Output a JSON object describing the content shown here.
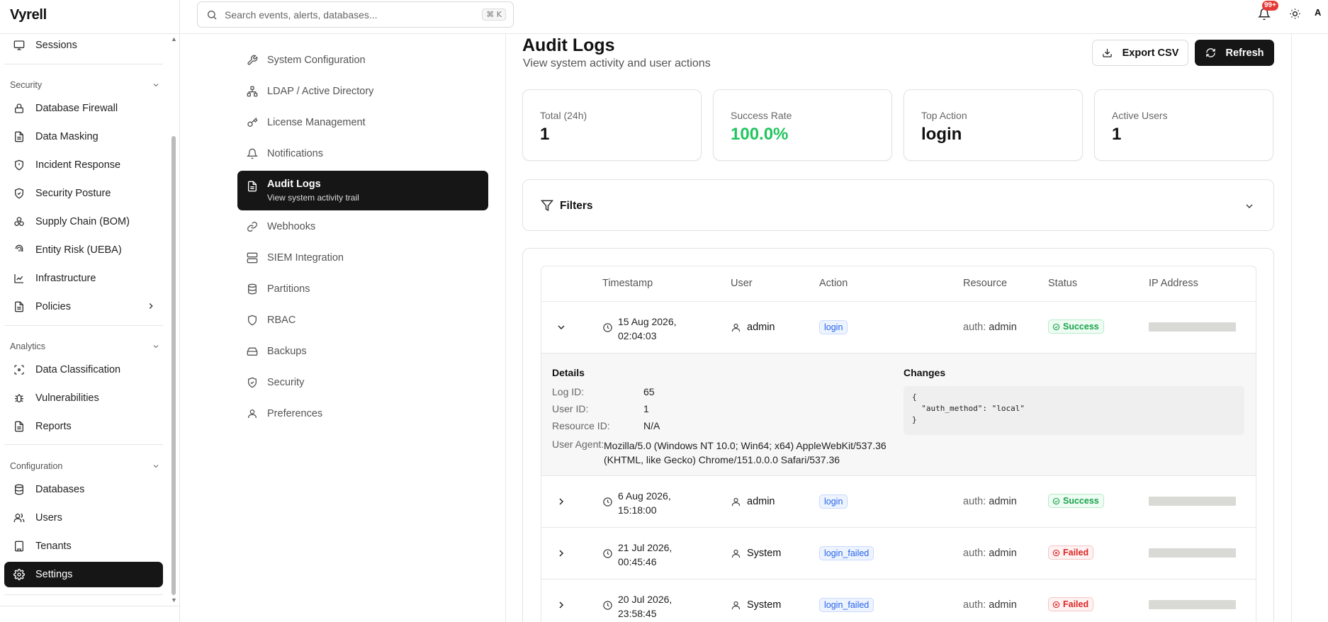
{
  "app": {
    "brand": "Vyrell"
  },
  "topbar": {
    "search_placeholder": "Search events, alerts, databases...",
    "search_shortcut": "⌘ K",
    "notifications_badge": "99+",
    "avatar_initial": "A"
  },
  "sidebar": {
    "top_items": [
      {
        "label": "Sessions",
        "icon": "monitor-icon"
      }
    ],
    "sections": [
      {
        "title": "Security",
        "items": [
          {
            "label": "Database Firewall",
            "icon": "lock-icon"
          },
          {
            "label": "Data Masking",
            "icon": "file-icon"
          },
          {
            "label": "Incident Response",
            "icon": "shield-alert-icon"
          },
          {
            "label": "Security Posture",
            "icon": "shield-check-icon"
          },
          {
            "label": "Supply Chain (BOM)",
            "icon": "boxes-icon"
          },
          {
            "label": "Entity Risk (UEBA)",
            "icon": "fingerprint-icon"
          },
          {
            "label": "Infrastructure",
            "icon": "chart-icon"
          },
          {
            "label": "Policies",
            "icon": "file-icon"
          }
        ]
      },
      {
        "title": "Analytics",
        "items": [
          {
            "label": "Data Classification",
            "icon": "scan-icon"
          },
          {
            "label": "Vulnerabilities",
            "icon": "bug-icon"
          },
          {
            "label": "Reports",
            "icon": "file-icon"
          }
        ]
      },
      {
        "title": "Configuration",
        "items": [
          {
            "label": "Databases",
            "icon": "database-icon"
          },
          {
            "label": "Users",
            "icon": "users-icon"
          },
          {
            "label": "Tenants",
            "icon": "building-icon"
          },
          {
            "label": "Settings",
            "icon": "gear-icon"
          }
        ]
      }
    ]
  },
  "settings_nav": {
    "items": [
      {
        "label": "System Configuration"
      },
      {
        "label": "LDAP / Active Directory"
      },
      {
        "label": "License Management"
      },
      {
        "label": "Notifications"
      },
      {
        "label": "Audit Logs",
        "sub": "View system activity trail"
      },
      {
        "label": "Webhooks"
      },
      {
        "label": "SIEM Integration"
      },
      {
        "label": "Partitions"
      },
      {
        "label": "RBAC"
      },
      {
        "label": "Backups"
      },
      {
        "label": "Security"
      },
      {
        "label": "Preferences"
      }
    ]
  },
  "page": {
    "title": "Audit Logs",
    "subtitle": "View system activity and user actions",
    "export_label": "Export CSV",
    "refresh_label": "Refresh"
  },
  "stats": [
    {
      "label": "Total (24h)",
      "value": "1"
    },
    {
      "label": "Success Rate",
      "value": "100.0%"
    },
    {
      "label": "Top Action",
      "value": "login"
    },
    {
      "label": "Active Users",
      "value": "1"
    }
  ],
  "filters": {
    "label": "Filters"
  },
  "table": {
    "columns": [
      "Timestamp",
      "User",
      "Action",
      "Resource",
      "Status",
      "IP Address"
    ],
    "rows": [
      {
        "ts1": "15 Aug 2026,",
        "ts2": "02:04:03",
        "user": "admin",
        "action": "login",
        "resource_type": "auth:",
        "resource": "admin",
        "status": "Success"
      },
      {
        "ts1": "6 Aug 2026,",
        "ts2": "15:18:00",
        "user": "admin",
        "action": "login",
        "resource_type": "auth:",
        "resource": "admin",
        "status": "Success"
      },
      {
        "ts1": "21 Jul 2026,",
        "ts2": "00:45:46",
        "user": "System",
        "action": "login_failed",
        "resource_type": "auth:",
        "resource": "admin",
        "status": "Failed"
      },
      {
        "ts1": "20 Jul 2026,",
        "ts2": "23:58:45",
        "user": "System",
        "action": "login_failed",
        "resource_type": "auth:",
        "resource": "admin",
        "status": "Failed"
      }
    ],
    "details": {
      "title": "Details",
      "log_id_label": "Log ID:",
      "log_id": "65",
      "user_id_label": "User ID:",
      "user_id": "1",
      "resource_id_label": "Resource ID:",
      "resource_id": "N/A",
      "user_agent_label": "User Agent:",
      "user_agent_1": "Mozilla/5.0 (Windows NT 10.0; Win64; x64) AppleWebKit/537.36",
      "user_agent_2": "(KHTML, like Gecko) Chrome/151.0.0.0 Safari/537.36",
      "changes_title": "Changes",
      "changes_json": "{\n  \"auth_method\": \"local\"\n}"
    }
  },
  "colors": {
    "accent_dark": "#161616",
    "success": "#22c55e",
    "failed": "#dc2626",
    "action_blue": "#2563eb"
  }
}
